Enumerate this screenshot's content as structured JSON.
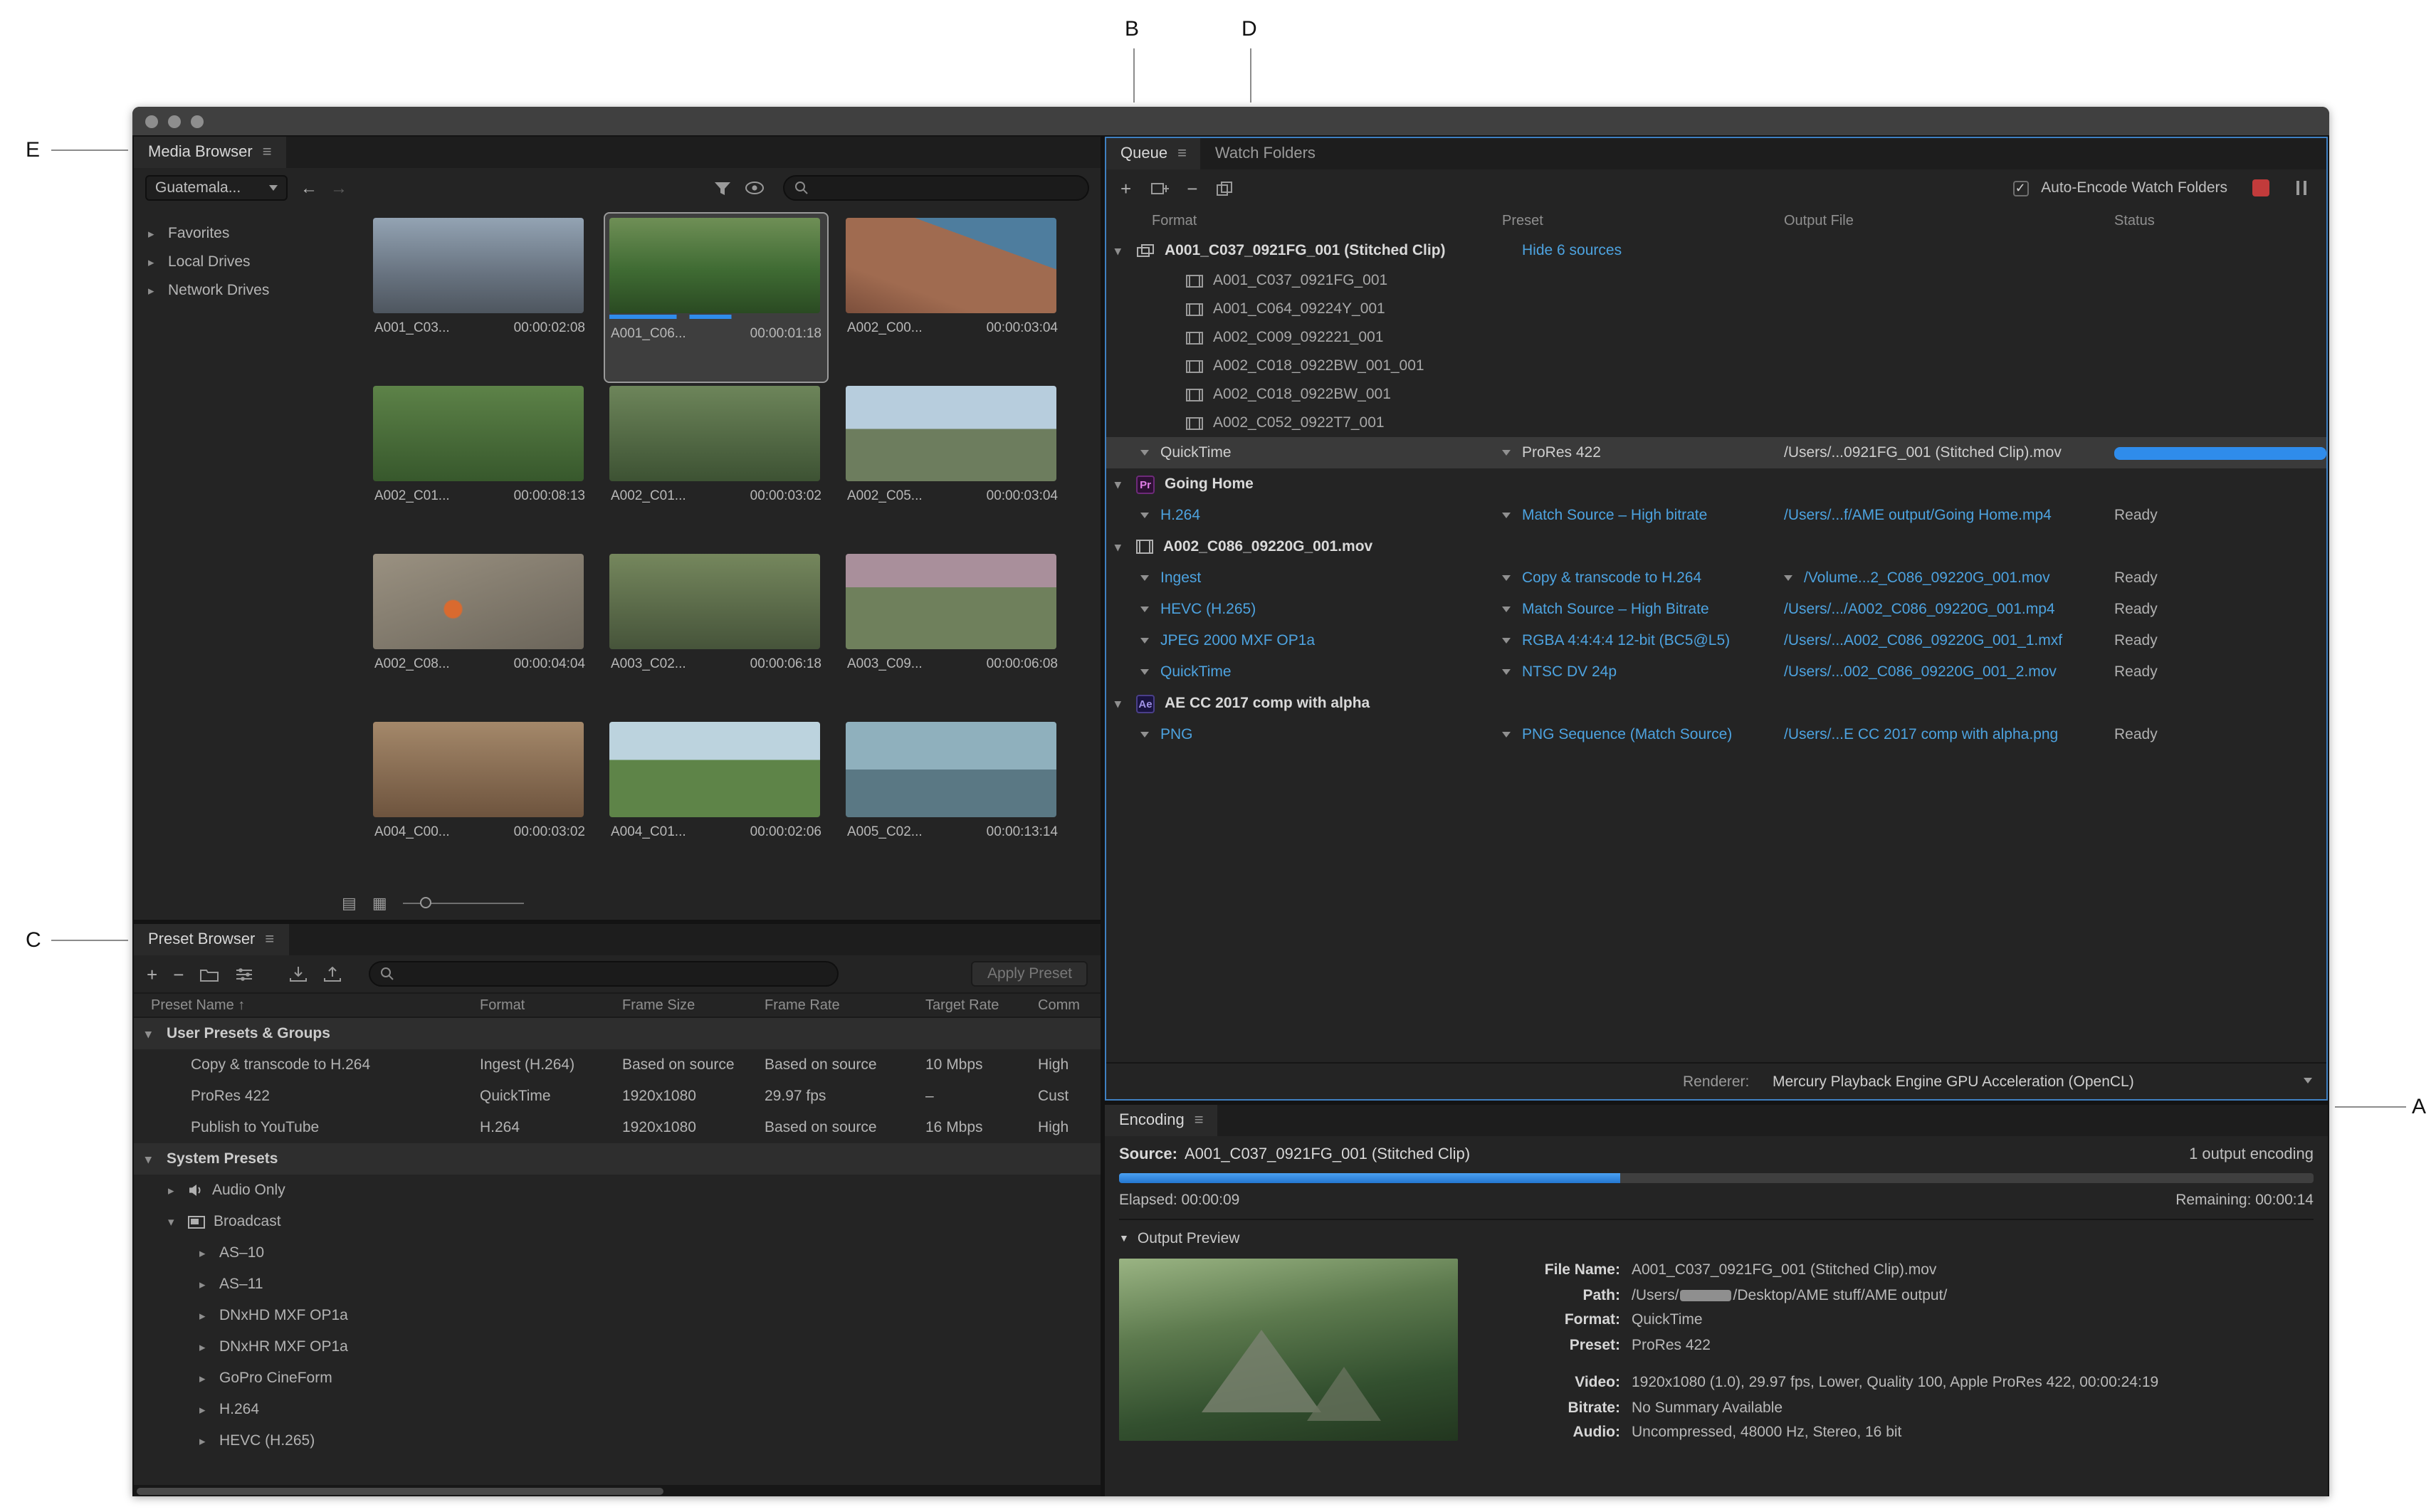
{
  "annotations": {
    "a": "A",
    "b": "B",
    "c": "C",
    "d": "D",
    "e": "E"
  },
  "icons": {
    "menu": "≡",
    "back": "←",
    "forward": "→",
    "expanded": "▾",
    "collapsed": "▸",
    "plus": "+",
    "minus": "−",
    "sort_up": "↑",
    "section_collapse": "▼",
    "list_view": "▤",
    "grid_view": "▦",
    "check": "✓",
    "pr": "Pr",
    "ae": "Ae"
  },
  "colors": {
    "accent_blue": "#4da3e0",
    "progress_blue": "#2f8ceb",
    "stop_red": "#c23b3b",
    "panel_bg": "#242424"
  },
  "media_browser": {
    "title": "Media Browser",
    "location": "Guatemala...",
    "tree": {
      "favorites": "Favorites",
      "local_drives": "Local Drives",
      "network_drives": "Network Drives"
    },
    "clips": [
      {
        "name": "A001_C03...",
        "duration": "00:00:02:08"
      },
      {
        "name": "A001_C06...",
        "duration": "00:00:01:18"
      },
      {
        "name": "A002_C00...",
        "duration": "00:00:03:04"
      },
      {
        "name": "A002_C01...",
        "duration": "00:00:08:13"
      },
      {
        "name": "A002_C01...",
        "duration": "00:00:03:02"
      },
      {
        "name": "A002_C05...",
        "duration": "00:00:03:04"
      },
      {
        "name": "A002_C08...",
        "duration": "00:00:04:04"
      },
      {
        "name": "A003_C02...",
        "duration": "00:00:06:18"
      },
      {
        "name": "A003_C09...",
        "duration": "00:00:06:08"
      },
      {
        "name": "A004_C00...",
        "duration": "00:00:03:02"
      },
      {
        "name": "A004_C01...",
        "duration": "00:00:02:06"
      },
      {
        "name": "A005_C02...",
        "duration": "00:00:13:14"
      }
    ]
  },
  "preset_browser": {
    "title": "Preset Browser",
    "apply_label": "Apply Preset",
    "columns": {
      "name": "Preset Name",
      "format": "Format",
      "frame_size": "Frame Size",
      "frame_rate": "Frame Rate",
      "target_rate": "Target Rate",
      "comment": "Comm"
    },
    "groups": {
      "user": "User Presets & Groups",
      "system": "System Presets"
    },
    "user_presets": [
      {
        "name": "Copy & transcode to H.264",
        "format": "Ingest (H.264)",
        "frame_size": "Based on source",
        "frame_rate": "Based on source",
        "target_rate": "10 Mbps",
        "comment": "High"
      },
      {
        "name": "ProRes 422",
        "format": "QuickTime",
        "frame_size": "1920x1080",
        "frame_rate": "29.97 fps",
        "target_rate": "–",
        "comment": "Cust"
      },
      {
        "name": "Publish to YouTube",
        "format": "H.264",
        "frame_size": "1920x1080",
        "frame_rate": "Based on source",
        "target_rate": "16 Mbps",
        "comment": "High"
      }
    ],
    "system_items": {
      "audio_only": "Audio Only",
      "broadcast": "Broadcast"
    },
    "broadcast_children": [
      "AS–10",
      "AS–11",
      "DNxHD MXF OP1a",
      "DNxHR MXF OP1a",
      "GoPro CineForm",
      "H.264",
      "HEVC (H.265)"
    ]
  },
  "queue": {
    "tabs": {
      "queue": "Queue",
      "watch_folders": "Watch Folders"
    },
    "auto_encode_label": "Auto-Encode Watch Folders",
    "columns": {
      "format": "Format",
      "preset": "Preset",
      "output": "Output File",
      "status": "Status"
    },
    "job1": {
      "title": "A001_C037_0921FG_001 (Stitched Clip)",
      "hide_sources": "Hide 6 sources",
      "sources": [
        "A001_C037_0921FG_001",
        "A001_C064_09224Y_001",
        "A002_C009_092221_001",
        "A002_C018_0922BW_001_001",
        "A002_C018_0922BW_001",
        "A002_C052_0922T7_001"
      ],
      "output": {
        "format": "QuickTime",
        "preset": "ProRes 422",
        "file": "/Users/...0921FG_001 (Stitched Clip).mov",
        "progress_pct": 100
      }
    },
    "job2": {
      "title": "Going Home",
      "outputs": [
        {
          "format": "H.264",
          "preset": "Match Source – High bitrate",
          "file": "/Users/...f/AME output/Going Home.mp4",
          "status": "Ready"
        }
      ]
    },
    "job3": {
      "title": "A002_C086_09220G_001.mov",
      "outputs": [
        {
          "format": "Ingest",
          "preset": "Copy & transcode to H.264",
          "file": "/Volume...2_C086_09220G_001.mov",
          "status": "Ready"
        },
        {
          "format": "HEVC (H.265)",
          "preset": "Match Source – High Bitrate",
          "file": "/Users/.../A002_C086_09220G_001.mp4",
          "status": "Ready"
        },
        {
          "format": "JPEG 2000 MXF OP1a",
          "preset": "RGBA 4:4:4:4 12-bit (BC5@L5)",
          "file": "/Users/...A002_C086_09220G_001_1.mxf",
          "status": "Ready"
        },
        {
          "format": "QuickTime",
          "preset": "NTSC DV 24p",
          "file": "/Users/...002_C086_09220G_001_2.mov",
          "status": "Ready"
        }
      ]
    },
    "job4": {
      "title": "AE CC 2017 comp with alpha",
      "outputs": [
        {
          "format": "PNG",
          "preset": "PNG Sequence (Match Source)",
          "file": "/Users/...E CC 2017 comp with alpha.png",
          "status": "Ready"
        }
      ]
    },
    "renderer_label": "Renderer:",
    "renderer_value": "Mercury Playback Engine GPU Acceleration (OpenCL)"
  },
  "encoding": {
    "title": "Encoding",
    "source_label": "Source:",
    "source_value": "A001_C037_0921FG_001 (Stitched Clip)",
    "outputs_note": "1 output encoding",
    "progress_pct": 42,
    "elapsed": "Elapsed: 00:00:09",
    "remaining": "Remaining: 00:00:14",
    "section": "Output Preview",
    "details": {
      "file_name_label": "File Name:",
      "file_name": "A001_C037_0921FG_001 (Stitched Clip).mov",
      "path_label": "Path:",
      "path_prefix": "/Users/",
      "path_suffix": "/Desktop/AME stuff/AME output/",
      "format_label": "Format:",
      "format": "QuickTime",
      "preset_label": "Preset:",
      "preset": "ProRes 422",
      "video_label": "Video:",
      "video": "1920x1080 (1.0), 29.97 fps, Lower, Quality 100, Apple ProRes 422, 00:00:24:19",
      "bitrate_label": "Bitrate:",
      "bitrate": "No Summary Available",
      "audio_label": "Audio:",
      "audio": "Uncompressed, 48000 Hz, Stereo, 16 bit"
    }
  }
}
